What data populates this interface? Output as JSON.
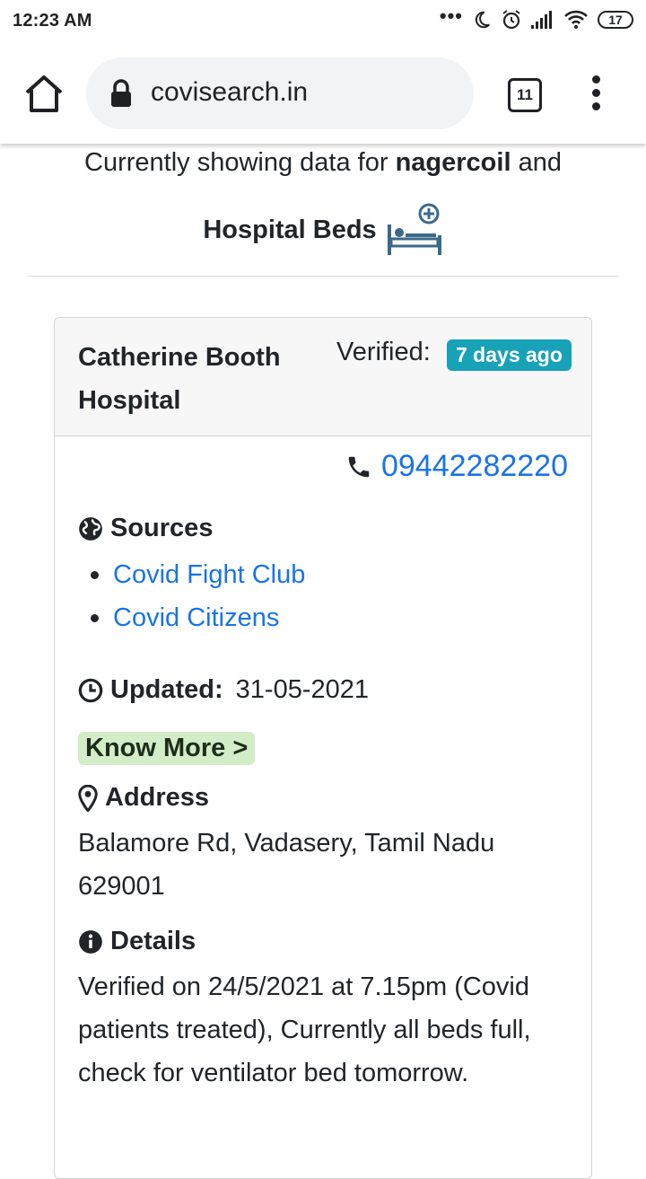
{
  "status_bar": {
    "time": "12:23 AM",
    "battery": "17"
  },
  "browser": {
    "url": "covisearch.in",
    "tab_count": "11"
  },
  "heading": {
    "prefix": "Currently showing data for ",
    "city": "nagercoil",
    "suffix": " and",
    "resource": "Hospital Beds"
  },
  "card": {
    "hospital_name": "Catherine Booth Hospital",
    "verified_label": "Verified:",
    "verified_badge": "7 days ago",
    "phone": "09442282220",
    "sources_title": "Sources",
    "sources": [
      "Covid Fight Club",
      "Covid Citizens"
    ],
    "updated_label": "Updated:",
    "updated_value": "31-05-2021",
    "know_more": "Know More >",
    "address_title": "Address",
    "address": "Balamore Rd, Vadasery, Tamil Nadu 629001",
    "details_title": "Details",
    "details": "Verified on 24/5/2021 at 7.15pm (Covid patients treated), Currently all beds full, check for ventilator bed tomorrow."
  },
  "colors": {
    "badge": "#17a2b8",
    "link": "#1a73e8",
    "know_more_bg": "#d4edc9"
  }
}
